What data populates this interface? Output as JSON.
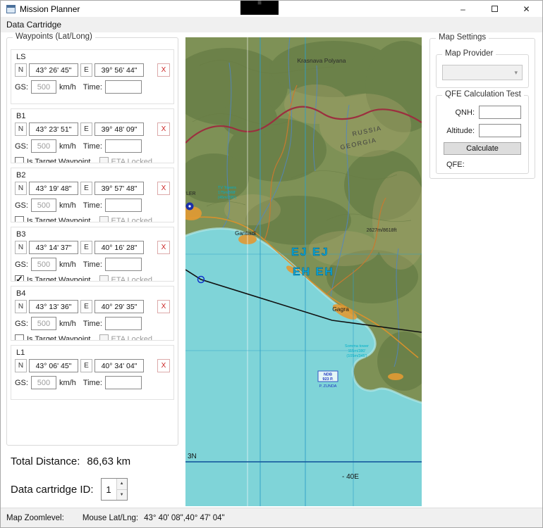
{
  "window": {
    "title": "Mission Planner"
  },
  "icons": {
    "minimize": "–",
    "close": "✕",
    "combo_arrow": "▾",
    "spinner_up": "▲",
    "spinner_down": "▼",
    "menu_grip": "≡",
    "delete": "X"
  },
  "menu": {
    "items": [
      "Data Cartridge"
    ]
  },
  "waypoints_panel": {
    "title": "Waypoints (Lat/Long)",
    "labels": {
      "n": "N",
      "e": "E",
      "gs": "GS:",
      "unit": "km/h",
      "time": "Time:",
      "target": "Is Target Waypoint",
      "eta": "ETA Locked"
    },
    "waypoints": [
      {
        "name": "LS",
        "lat": "43° 26' 45\"",
        "lng": "39° 56' 44\"",
        "gs": "500",
        "time": "",
        "target": false,
        "eta": false
      },
      {
        "name": "B1",
        "lat": "43° 23' 51\"",
        "lng": "39° 48' 09\"",
        "gs": "500",
        "time": "",
        "target": false,
        "eta": false
      },
      {
        "name": "B2",
        "lat": "43° 19' 48\"",
        "lng": "39° 57' 48\"",
        "gs": "500",
        "time": "",
        "target": false,
        "eta": false
      },
      {
        "name": "B3",
        "lat": "43° 14' 37\"",
        "lng": "40° 16' 28\"",
        "gs": "500",
        "time": "",
        "target": true,
        "eta": false
      },
      {
        "name": "B4",
        "lat": "43° 13' 36\"",
        "lng": "40° 29' 35\"",
        "gs": "500",
        "time": "",
        "target": false,
        "eta": false
      },
      {
        "name": "L1",
        "lat": "43° 06' 45\"",
        "lng": "40° 34' 04\"",
        "gs": "500",
        "time": "",
        "target": false,
        "eta": false
      }
    ],
    "total_distance_label": "Total Distance:",
    "total_distance_value": "86,63 km",
    "cartridge_label": "Data cartridge ID:",
    "cartridge_value": "1"
  },
  "map_settings": {
    "title": "Map Settings",
    "provider_title": "Map Provider",
    "provider_value": "",
    "qfe_title": "QFE Calculation Test",
    "qnh_label": "QNH:",
    "qnh_value": "",
    "altitude_label": "Altitude:",
    "altitude_value": "",
    "calculate_label": "Calculate",
    "qfe_label": "QFE:"
  },
  "map": {
    "labels": {
      "town1": "Krasnava Polyana",
      "country1": "RUSSIA",
      "country2": "GEORGIA",
      "town2": "Gantiadi",
      "town3": "Gagra",
      "peak": "2627m/8618ft",
      "grid1": "EJ  EJ",
      "grid2": "EH EH",
      "tv1": "TV Towers",
      "tv2": "175m/568'",
      "tv3": "(45m/295')",
      "somma1": "Somma tower",
      "somma2": "115m/380'",
      "somma3": "(105m/345')",
      "ndb1": "NDB",
      "ndb2": "923 P.",
      "ndb3": "P. ZUNDA",
      "edge": "LER",
      "lat_line": "3N",
      "lon_line": "- 40E"
    }
  },
  "status_bar": {
    "zoom_label": "Map Zoomlevel:",
    "mouse_label": "Mouse Lat/Lng:",
    "mouse_value": "43° 40' 08\",40° 47' 04\""
  }
}
